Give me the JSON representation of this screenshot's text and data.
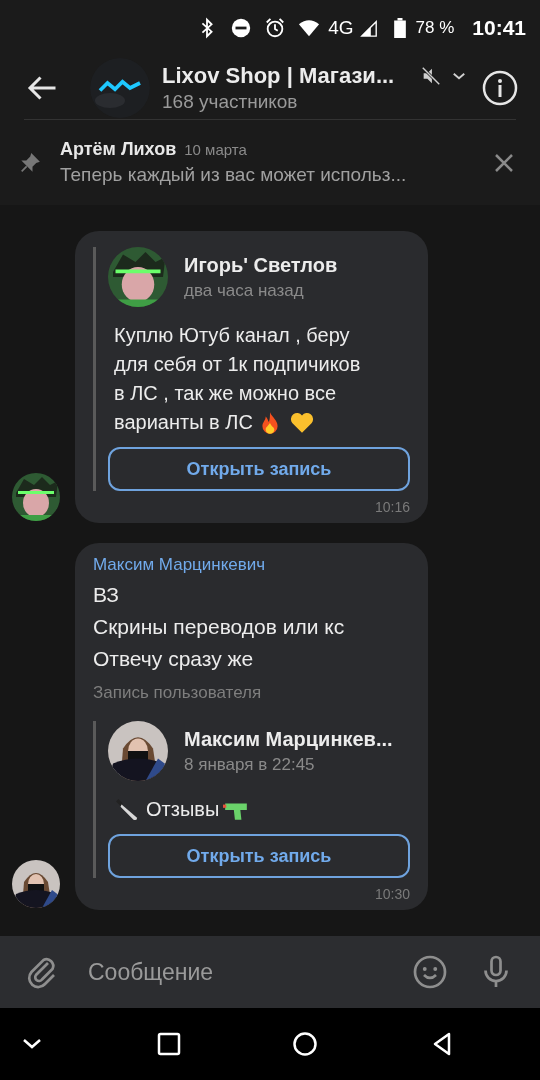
{
  "status_bar": {
    "network": "4G",
    "battery": "78 %",
    "time": "10:41"
  },
  "header": {
    "title": "Lixov Shop | Магази...",
    "subtitle": "168 участников",
    "muted": true
  },
  "pinned": {
    "author": "Артём Лихов",
    "date": "10 марта",
    "text": "Теперь каждый из вас может использ..."
  },
  "messages": [
    {
      "repost": {
        "author": "Игорь' Светлов",
        "date": "два часа назад",
        "content": [
          {
            "kind": "text",
            "text": "Куплю Ютуб канал , беру\nдля себя от 1к подпичиков\nв ЛС , так же можно все"
          },
          {
            "kind": "text",
            "text": "варианты в ЛС"
          },
          {
            "kind": "fire"
          },
          {
            "kind": "heart"
          }
        ],
        "button": "Открыть запись"
      },
      "time": "10:16"
    },
    {
      "sender": "Максим Марцинкевич",
      "body": "ВЗ\nСкрины переводов или кс\nОтвечу сразу же",
      "repost_label": "Запись пользователя",
      "repost": {
        "author": "Максим Марцинкев...",
        "date": "8 января в 22:45",
        "content": [
          {
            "kind": "knife"
          },
          {
            "kind": "text",
            "text": "Отзывы"
          },
          {
            "kind": "gun"
          }
        ],
        "button": "Открыть запись"
      },
      "time": "10:30"
    }
  ],
  "composer": {
    "placeholder": "Сообщение"
  }
}
